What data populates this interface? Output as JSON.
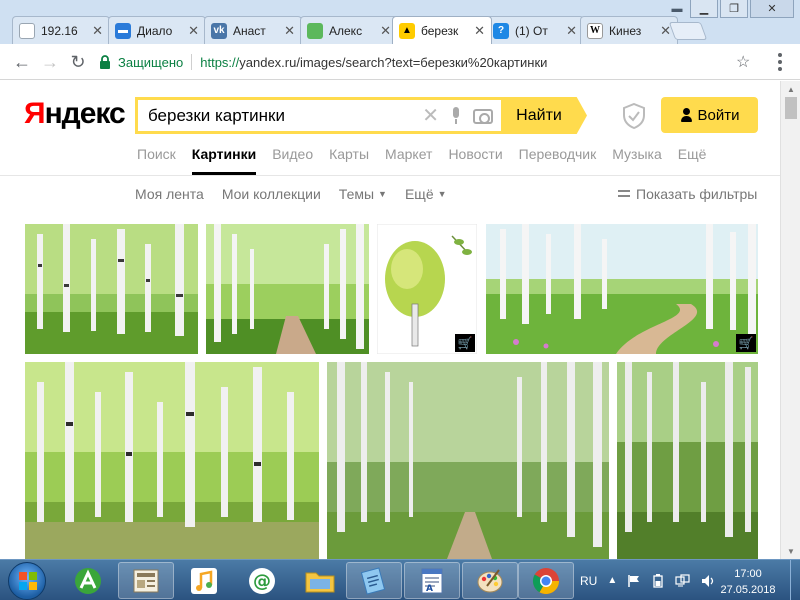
{
  "browser": {
    "tabs": [
      {
        "label": "192.16",
        "icon_name": "page-icon",
        "color": "#9aa6b2"
      },
      {
        "label": "Диало",
        "icon_name": "chat-icon",
        "color": "#2b7bd9"
      },
      {
        "label": "Анаст",
        "icon_name": "vk-icon",
        "color": "#4a76a8"
      },
      {
        "label": "Алекс",
        "icon_name": "green-square-icon",
        "color": "#5cb85c"
      },
      {
        "label": "березк",
        "icon_name": "yandex-images-icon",
        "color": "#ffcc00",
        "active": true
      },
      {
        "label": "(1) От",
        "icon_name": "question-icon",
        "color": "#1e88e5"
      },
      {
        "label": "Кинез",
        "icon_name": "wikipedia-icon",
        "color": "#ffffff"
      }
    ],
    "secure_label": "Защищено",
    "url_scheme": "https://",
    "url_rest": "yandex.ru/images/search?text=березки%20картинки"
  },
  "header": {
    "logo_first": "Я",
    "logo_rest": "ндекс",
    "search_value": "березки картинки",
    "search_button": "Найти",
    "login_button": "Войти"
  },
  "services": [
    {
      "label": "Поиск"
    },
    {
      "label": "Картинки",
      "active": true
    },
    {
      "label": "Видео"
    },
    {
      "label": "Карты"
    },
    {
      "label": "Маркет"
    },
    {
      "label": "Новости"
    },
    {
      "label": "Переводчик"
    },
    {
      "label": "Музыка"
    },
    {
      "label": "Ещё"
    }
  ],
  "subnav": {
    "feed": "Моя лента",
    "collections": "Мои коллекции",
    "themes": "Темы",
    "more": "Ещё",
    "filters": "Показать фильтры"
  },
  "results": [
    {
      "name": "birch-grove-1",
      "shop": false
    },
    {
      "name": "birch-alley-path",
      "shop": false
    },
    {
      "name": "birch-drawing",
      "shop": true
    },
    {
      "name": "birch-painting-path",
      "shop": true
    },
    {
      "name": "birch-grove-2",
      "shop": false
    },
    {
      "name": "birch-forest-road",
      "shop": false
    },
    {
      "name": "birch-forest-3",
      "shop": false
    }
  ],
  "taskbar": {
    "lang": "RU",
    "time": "17:00",
    "date": "27.05.2018"
  },
  "colors": {
    "accent": "#ffdb4d",
    "secure_green": "#0b8043",
    "yandex_red": "#ff0000"
  }
}
